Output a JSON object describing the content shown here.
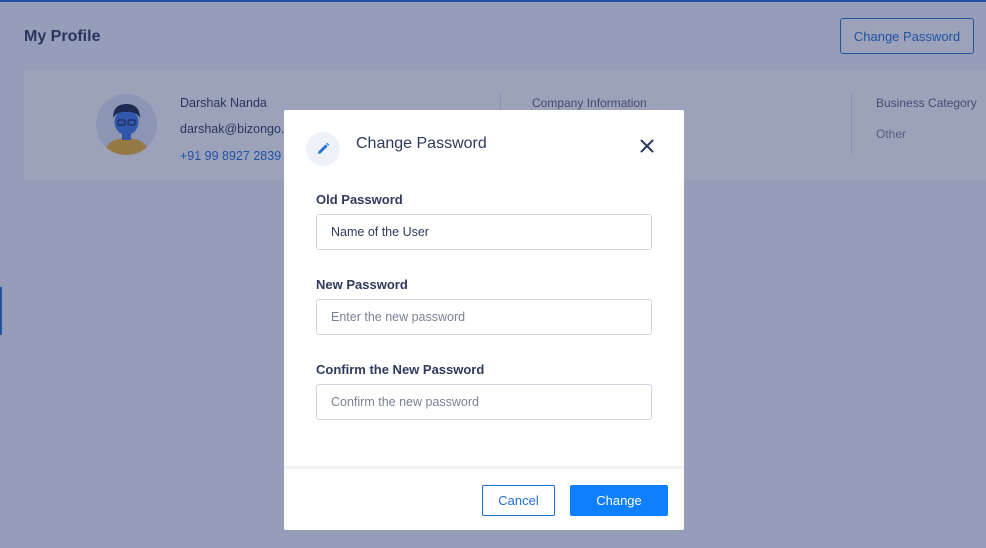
{
  "page": {
    "title": "My Profile",
    "change_password_button": "Change Password"
  },
  "profile": {
    "name": "Darshak Nanda",
    "email": "darshak@bizongo.com",
    "phone": "+91 99 8927 2839",
    "company_info_label": "Company Information",
    "business_category_label": "Business Category",
    "business_category_value": "Other"
  },
  "modal": {
    "title": "Change Password",
    "fields": [
      {
        "label": "Old Password",
        "value": "Name of the User",
        "placeholder": ""
      },
      {
        "label": "New Password",
        "value": "",
        "placeholder": "Enter the new password"
      },
      {
        "label": "Confirm the New Password",
        "value": "",
        "placeholder": "Confirm the new password"
      }
    ],
    "cancel_label": "Cancel",
    "submit_label": "Change"
  },
  "icons": {
    "modal_icon": "pencil-icon",
    "close": "close-icon",
    "avatar": "user-avatar"
  },
  "colors": {
    "accent": "#1f6fd6",
    "primary_button": "#0d7fff",
    "overlay": "rgba(36,48,102,0.45)"
  }
}
